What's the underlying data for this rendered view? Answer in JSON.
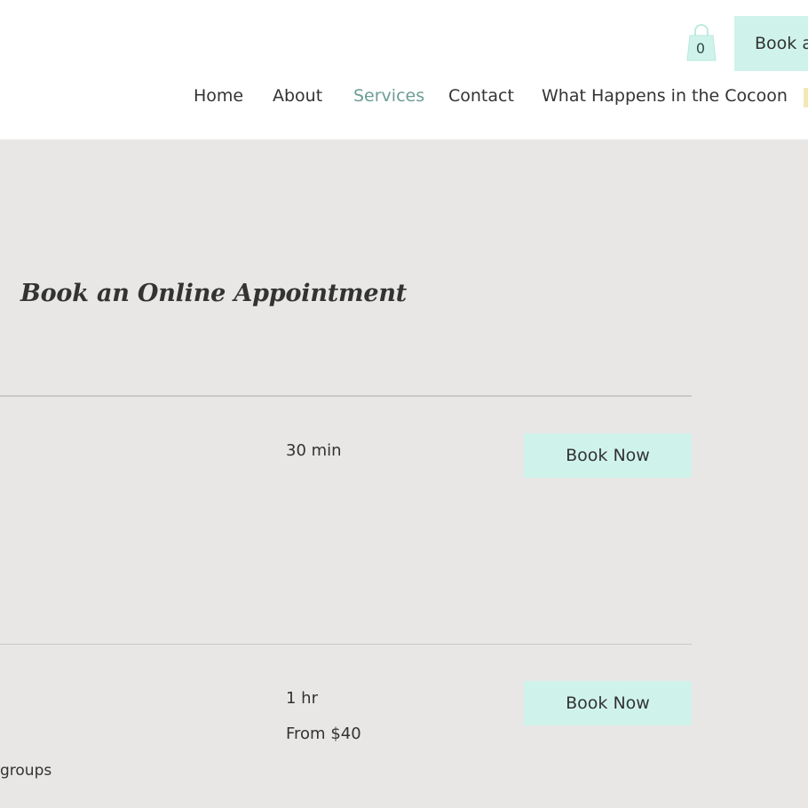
{
  "header": {
    "cart": {
      "count": "0",
      "icon": "shopping-bag-icon"
    },
    "book_button_label": "Book a",
    "nav": {
      "items": [
        {
          "label": "Home",
          "active": false
        },
        {
          "label": "About",
          "active": false
        },
        {
          "label": "Services",
          "active": true
        },
        {
          "label": "Contact",
          "active": false
        },
        {
          "label": "What Happens in the Cocoon",
          "active": false
        }
      ]
    }
  },
  "main": {
    "title": "Book an Online Appointment",
    "services": [
      {
        "duration": "30 min",
        "price": "",
        "button_label": "Book Now",
        "description": ""
      },
      {
        "duration": "1 hr",
        "price": "From $40",
        "button_label": "Book Now",
        "description": "groups"
      }
    ]
  },
  "colors": {
    "accent": "#cff3ea",
    "nav_active": "#6d9d95",
    "background": "#e8e7e5"
  }
}
